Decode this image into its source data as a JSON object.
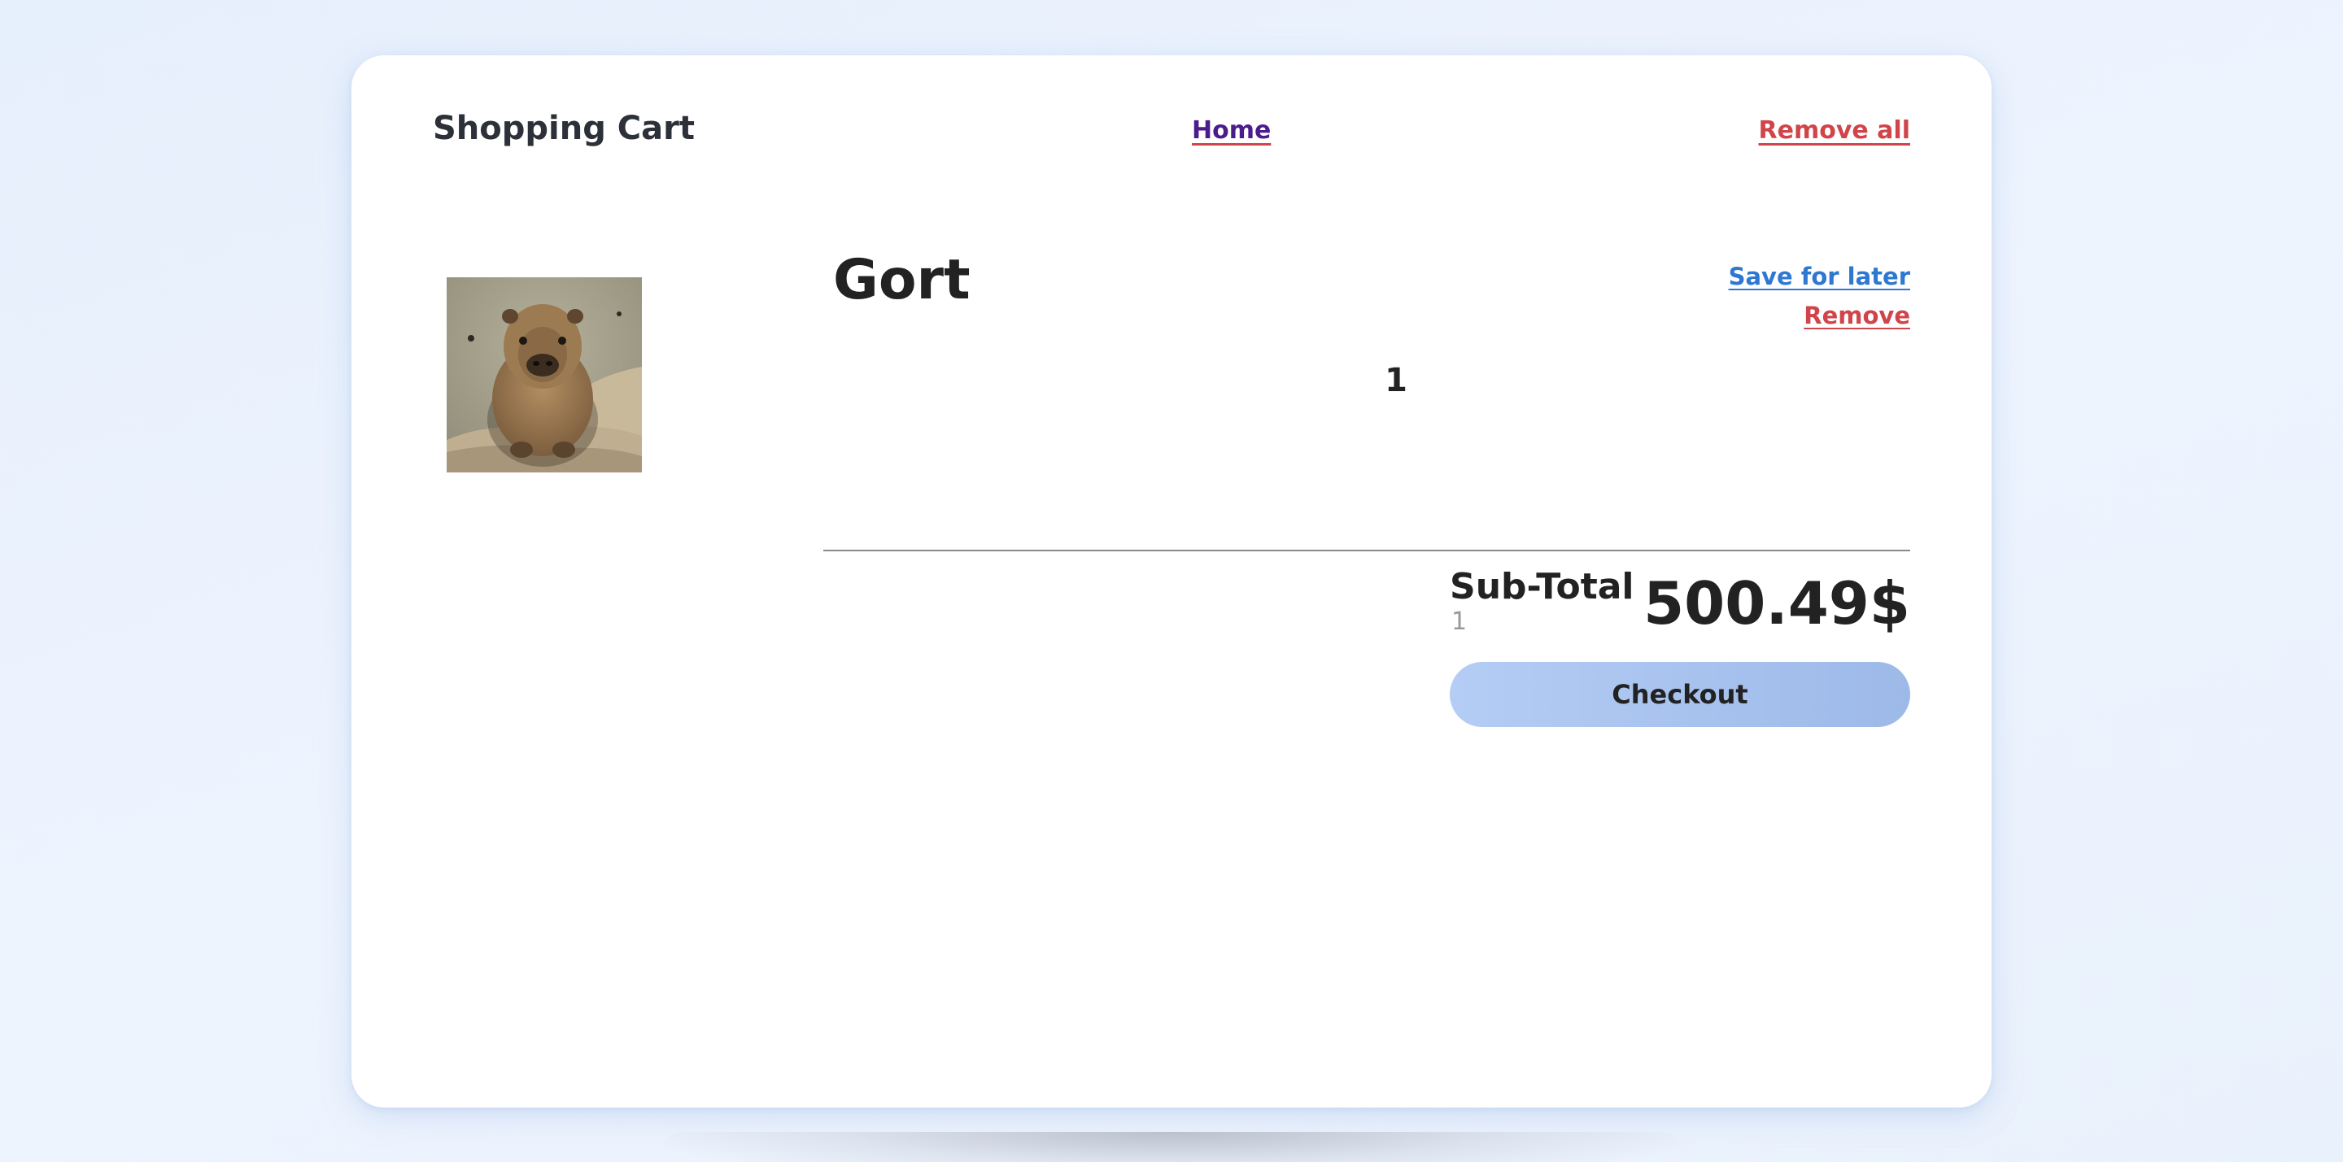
{
  "header": {
    "title": "Shopping Cart",
    "home_label": "Home",
    "remove_all_label": "Remove all"
  },
  "item": {
    "name": "Gort",
    "image_icon": "capybara-photo",
    "quantity": "1",
    "save_for_later_label": "Save for later",
    "remove_label": "Remove"
  },
  "summary": {
    "subtotal_label": "Sub-Total",
    "item_count": "1",
    "total_price": "500.49$",
    "checkout_label": "Checkout"
  },
  "colors": {
    "link_blue": "#2e78d2",
    "link_red": "#d0444a",
    "home_purple": "#4b1c8c",
    "checkout_bg": "#a9c4f0"
  }
}
